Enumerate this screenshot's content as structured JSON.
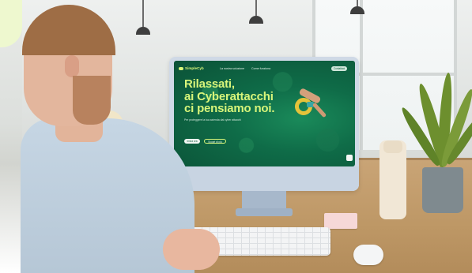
{
  "scene": {
    "screen": {
      "brand": "SimpleCyb",
      "nav_items": [
        "La nostra soluzione",
        "Come funziona"
      ],
      "nav_cta": "Contattaci",
      "headline": [
        "Rilassati,",
        "ai Cyberattacchi",
        "ci pensiamo noi."
      ],
      "subline": "Per proteggere la tua azienda dai cyber attacchi",
      "primary_button": "Inizia ora",
      "secondary_button": "Scopri di più"
    }
  }
}
